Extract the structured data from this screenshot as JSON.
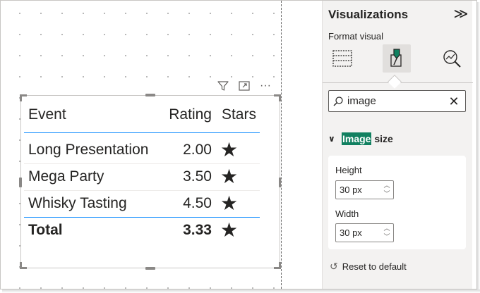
{
  "table": {
    "columns": [
      "Event",
      "Rating",
      "Stars"
    ],
    "rows": [
      {
        "event": "Long Presentation",
        "rating": "2.00",
        "stars": "★"
      },
      {
        "event": "Mega Party",
        "rating": "3.50",
        "stars": "★"
      },
      {
        "event": "Whisky Tasting",
        "rating": "4.50",
        "stars": "★"
      }
    ],
    "total": {
      "label": "Total",
      "rating": "3.33",
      "stars": "★"
    }
  },
  "visual_header": {
    "icons": [
      "filter-icon",
      "focus-mode-icon",
      "more-options-icon"
    ],
    "more_label": "···"
  },
  "pane": {
    "title": "Visualizations",
    "collapse_glyph": "≫",
    "subtitle": "Format visual",
    "tabs": [
      "build-visual",
      "format-visual",
      "analytics"
    ],
    "active_tab": "format-visual",
    "search": {
      "value": "image",
      "clear_glyph": "✕"
    },
    "section": {
      "chevron": "∨",
      "highlight": "Image",
      "rest": " size"
    },
    "fields": [
      {
        "label": "Height",
        "value": "30 px"
      },
      {
        "label": "Width",
        "value": "30 px"
      }
    ],
    "spin_up": "︿",
    "spin_down": "﹀",
    "reset": {
      "glyph": "↺",
      "label": "Reset to default"
    }
  },
  "colors": {
    "accent_blue": "#118dff",
    "highlight_green": "#118060",
    "pane_bg": "#f3f2f1"
  }
}
